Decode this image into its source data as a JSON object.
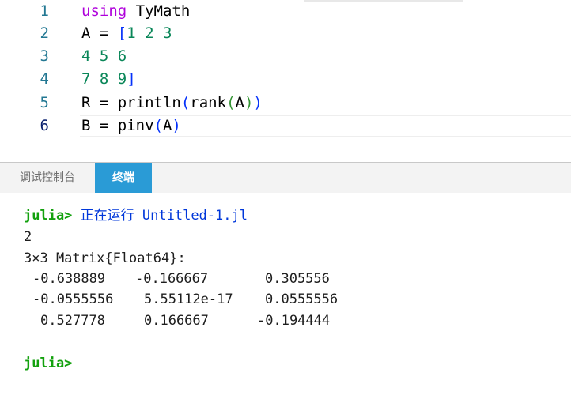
{
  "editor": {
    "lines": [
      {
        "number": "1",
        "tokens": {
          "keyword": "using",
          "rest": " TyMath"
        }
      },
      {
        "number": "2",
        "tokens": {
          "lhs": "A = ",
          "bracket": "[",
          "nums": "1 2 3"
        }
      },
      {
        "number": "3",
        "tokens": {
          "nums": "4 5 6"
        }
      },
      {
        "number": "4",
        "tokens": {
          "nums": "7 8 9",
          "bracket": "]"
        }
      },
      {
        "number": "5",
        "tokens": {
          "lhs": "R = println",
          "p1": "(",
          "call": "rank",
          "p2": "(",
          "arg": "A",
          "p3": ")",
          "p4": ")"
        }
      },
      {
        "number": "6",
        "tokens": {
          "lhs": "B = pinv",
          "p1": "(",
          "arg": "A",
          "p2": ")"
        }
      }
    ]
  },
  "panel": {
    "tabs": [
      {
        "label": "调试控制台"
      },
      {
        "label": "终端"
      }
    ]
  },
  "terminal": {
    "prompt": "julia>",
    "run_message": "正在运行 Untitled-1.jl",
    "rank_output": "2",
    "matrix_type": "3×3 Matrix{Float64}:",
    "matrix": [
      [
        "-0.638889",
        "-0.166667",
        "0.305556"
      ],
      [
        "-0.0555556",
        "5.55112e-17",
        "0.0555556"
      ],
      [
        "0.527778",
        "0.166667",
        "-0.194444"
      ]
    ],
    "final_prompt": "julia>"
  },
  "colors": {
    "keyword": "#af00db",
    "number": "#098658",
    "prompt": "#13a10e",
    "active_tab": "#2a9bd6",
    "line_number": "#237893"
  }
}
